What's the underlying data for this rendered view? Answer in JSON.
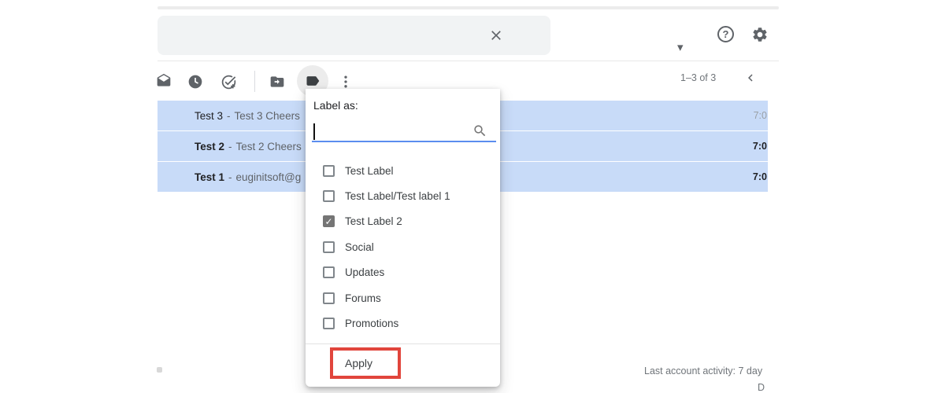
{
  "search": {
    "value": ""
  },
  "glyphs": {
    "caret": "▾",
    "help": "?",
    "check": "✓"
  },
  "pagination": {
    "count_label": "1–3 of 3"
  },
  "email_list": {
    "rows": [
      {
        "subject": "Test 3",
        "dash": "-",
        "snippet": "Test 3 Cheers",
        "time": "7:0",
        "unread": false
      },
      {
        "subject": "Test 2",
        "dash": "-",
        "snippet": "Test 2 Cheers",
        "time": "7:0",
        "unread": true
      },
      {
        "subject": "Test 1",
        "dash": "-",
        "snippet": "euginitsoft@g",
        "time": "7:0",
        "unread": true
      }
    ]
  },
  "label_menu": {
    "title": "Label as:",
    "search_value": "",
    "items": [
      {
        "label": "Test Label",
        "checked": false
      },
      {
        "label": "Test Label/Test label 1",
        "checked": false
      },
      {
        "label": "Test Label 2",
        "checked": true
      },
      {
        "label": "Social",
        "checked": false
      },
      {
        "label": "Updates",
        "checked": false
      },
      {
        "label": "Forums",
        "checked": false
      },
      {
        "label": "Promotions",
        "checked": false
      }
    ],
    "apply_label": "Apply"
  },
  "footer": {
    "activity_text": "Last account activity: 7 day",
    "details_partial": "D"
  },
  "colors": {
    "selected_row": "#c8dbf8",
    "icon_gray": "#5f6368",
    "search_bg": "#f1f3f4",
    "input_underline": "#5b8def",
    "annotation_red": "#e1453c"
  }
}
